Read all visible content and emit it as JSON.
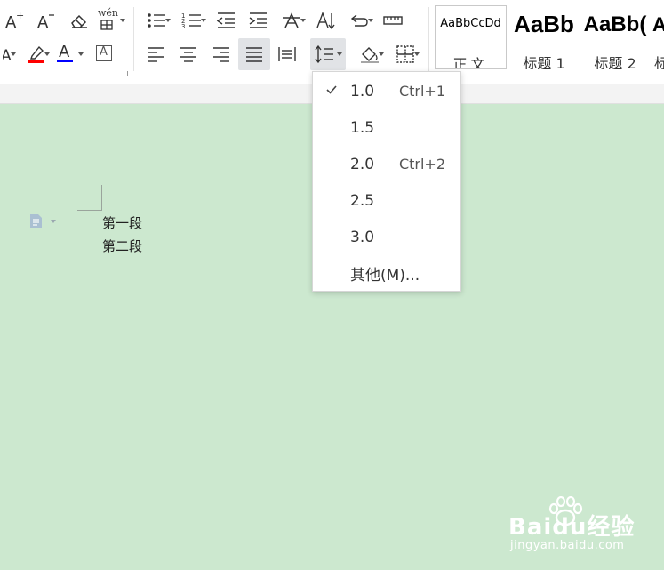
{
  "ribbon": {
    "pinyin_label": "wén",
    "font_color_letter": "A",
    "char_border_letter": "A",
    "style_gallery": [
      {
        "sample": "AaBbCcDd",
        "name": "正文",
        "selected": true
      },
      {
        "sample": "AaBb",
        "name": "标题 1",
        "selected": false
      },
      {
        "sample": "AaBb(",
        "name": "标题 2",
        "selected": false
      },
      {
        "sample": "A",
        "name": "标",
        "selected": false
      }
    ],
    "colors": {
      "highlight": "#ff0000",
      "font_color": "#0000ff",
      "active_bg": "#e1e3e6"
    }
  },
  "line_spacing_menu": {
    "items": [
      {
        "label": "1.0",
        "shortcut": "Ctrl+1",
        "checked": true
      },
      {
        "label": "1.5",
        "shortcut": "",
        "checked": false
      },
      {
        "label": "2.0",
        "shortcut": "Ctrl+2",
        "checked": false
      },
      {
        "label": "2.5",
        "shortcut": "",
        "checked": false
      },
      {
        "label": "3.0",
        "shortcut": "",
        "checked": false
      },
      {
        "label": "其他(M)...",
        "shortcut": "",
        "checked": false
      }
    ]
  },
  "document": {
    "paragraphs": [
      "第一段",
      "第二段"
    ],
    "background_color": "#cce8cf"
  },
  "watermark": {
    "brand": "Baidu经验",
    "sub": "jingyan.baidu.com"
  }
}
